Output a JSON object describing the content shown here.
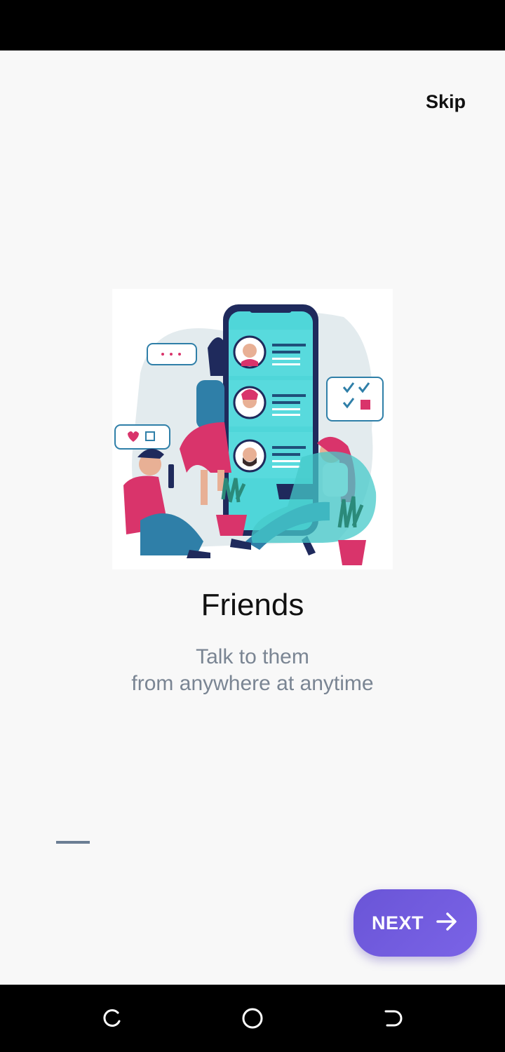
{
  "onboarding": {
    "skip_label": "Skip",
    "title": "Friends",
    "subtitle_line1": "Talk to them",
    "subtitle_line2": "from anywhere at anytime",
    "next_label": "NEXT",
    "page_indicator": {
      "current": 1
    }
  },
  "colors": {
    "accent": "#6a55d7",
    "subtitle": "#7a8593",
    "indicator": "#6b7e94",
    "background": "#f8f8f8"
  },
  "icons": {
    "next": "arrow-right-icon",
    "nav_recents": "recents-icon",
    "nav_home": "home-icon",
    "nav_back": "back-icon"
  }
}
